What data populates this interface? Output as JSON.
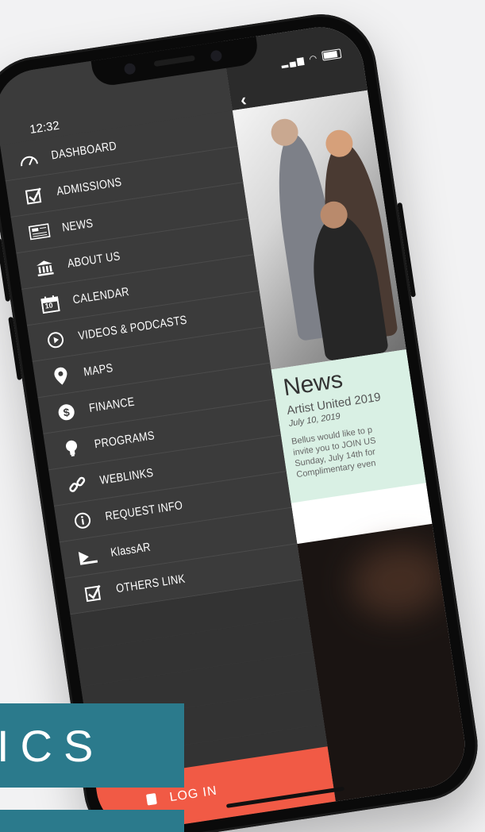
{
  "status_bar": {
    "time": "12:32",
    "icons": "signal-wifi-battery"
  },
  "menu": {
    "items": [
      {
        "label": "DASHBOARD",
        "icon": "dashboard-gauge-icon"
      },
      {
        "label": "ADMISSIONS",
        "icon": "checkbox-icon"
      },
      {
        "label": "NEWS",
        "icon": "newspaper-icon"
      },
      {
        "label": "ABOUT US",
        "icon": "bank-building-icon"
      },
      {
        "label": "CALENDAR",
        "icon": "calendar-icon",
        "day": "10"
      },
      {
        "label": "VIDEOS & PODCASTS",
        "icon": "play-circle-icon"
      },
      {
        "label": "MAPS",
        "icon": "map-pin-icon"
      },
      {
        "label": "FINANCE",
        "icon": "dollar-coin-icon"
      },
      {
        "label": "PROGRAMS",
        "icon": "lightbulb-icon"
      },
      {
        "label": "WEBLINKS",
        "icon": "link-chain-icon"
      },
      {
        "label": "REQUEST INFO",
        "icon": "info-circle-icon"
      },
      {
        "label": "KlassAR",
        "icon": "scanner-icon"
      },
      {
        "label": "OTHERS LINK",
        "icon": "checkbox-icon"
      }
    ],
    "login_label": "LOG IN"
  },
  "content": {
    "news_card": {
      "title": "News",
      "headline": "Artist United 2019",
      "date": "July 10, 2019",
      "body_lines": [
        "Bellus would like to p",
        "invite you to JOIN US",
        "Sunday, July 14th for",
        "Complimentary even"
      ]
    }
  },
  "banner": {
    "text": "ICS"
  },
  "colors": {
    "menu_bg": "#3b3b3b",
    "login_bg": "#f15a45",
    "news_bg": "#d9f0e4",
    "banner_bg": "#2b7a8c"
  }
}
